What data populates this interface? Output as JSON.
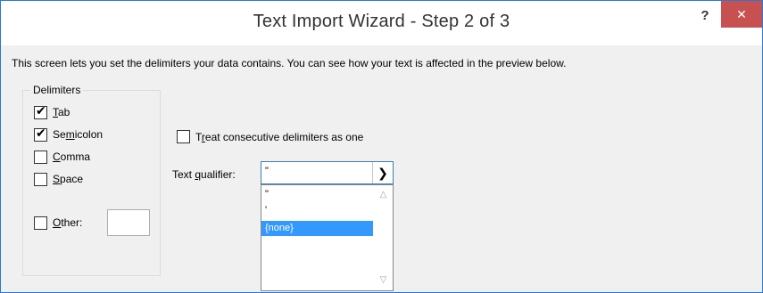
{
  "window": {
    "title": "Text Import Wizard - Step 2 of 3",
    "help_label": "?",
    "close_label": "✕"
  },
  "intro_text": "This screen lets you set the delimiters your data contains.  You can see how your text is affected in the preview below.",
  "delimiters": {
    "group_title": "Delimiters",
    "tab": {
      "label": "Tab",
      "mnemonic": "T",
      "checked": true
    },
    "semicolon": {
      "label": "Semicolon",
      "mnemonic": "m",
      "checked": true
    },
    "comma": {
      "label": "Comma",
      "mnemonic": "C",
      "checked": false
    },
    "space": {
      "label": "Space",
      "mnemonic": "S",
      "checked": false
    },
    "other": {
      "label": "Other:",
      "mnemonic": "O",
      "checked": false,
      "value": ""
    }
  },
  "treat_consecutive": {
    "label": "Treat consecutive delimiters as one",
    "mnemonic": "r",
    "checked": false
  },
  "text_qualifier": {
    "label": "Text qualifier:",
    "mnemonic": "q",
    "selected": "\"",
    "options": [
      "\"",
      "'",
      "{none}"
    ],
    "highlighted": "{none}"
  }
}
